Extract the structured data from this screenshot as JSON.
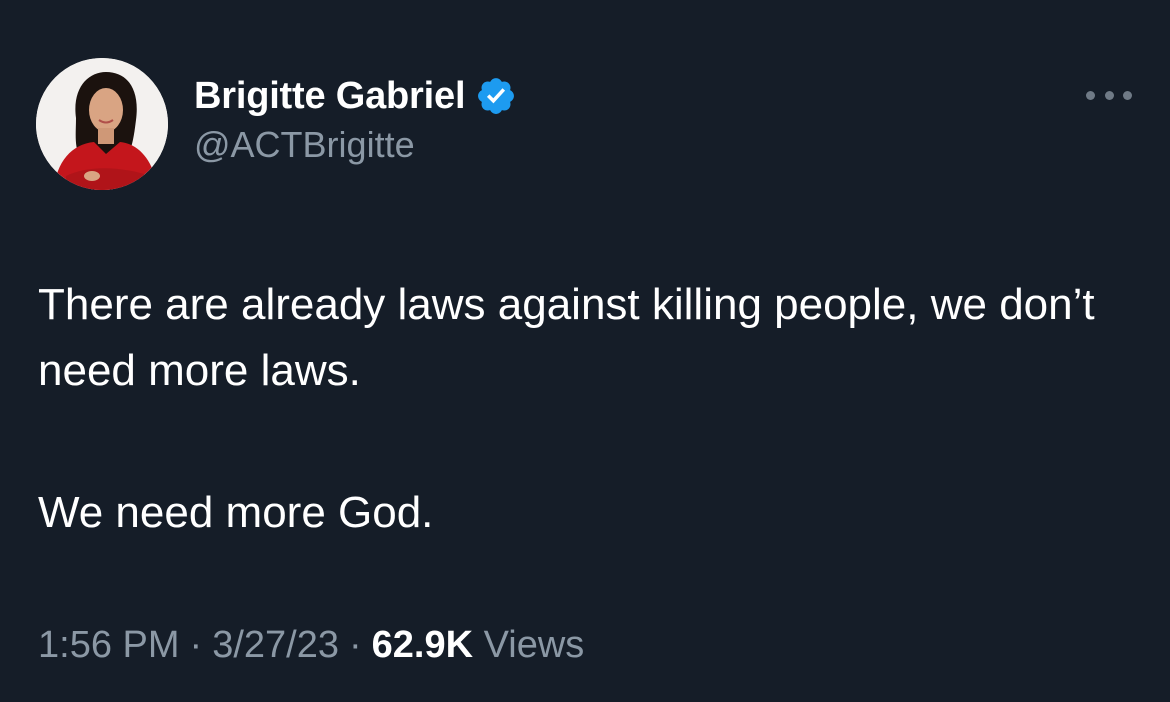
{
  "tweet": {
    "author": {
      "display_name": "Brigitte Gabriel",
      "handle": "@ACTBrigitte",
      "verified": true,
      "avatar": "profile-photo"
    },
    "more_icon": "more-horizontal-icon",
    "text": [
      "There are already laws against killing people, we don’t need more laws.",
      "We need more God."
    ],
    "time": "1:56 PM",
    "date": "3/27/23",
    "separator": "·",
    "views_count": "62.9K",
    "views_label": "Views"
  },
  "colors": {
    "background": "#151d28",
    "text_primary": "#ffffff",
    "text_secondary": "#8b98a5",
    "verified_badge": "#1d9bf0"
  }
}
